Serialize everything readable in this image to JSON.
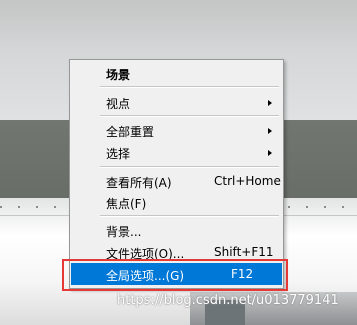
{
  "watermark": "https://blog.csdn.net/u013779141",
  "menu": {
    "header": {
      "label": "场景"
    },
    "items": [
      {
        "label": "视点",
        "shortcut": "",
        "submenu": true
      },
      {
        "label": "全部重置",
        "shortcut": "",
        "submenu": true
      },
      {
        "label": "选择",
        "shortcut": "",
        "submenu": true
      },
      {
        "label": "查看所有(A)",
        "shortcut": "Ctrl+Home",
        "submenu": false
      },
      {
        "label": "焦点(F)",
        "shortcut": "",
        "submenu": false
      },
      {
        "label": "背景...",
        "shortcut": "",
        "submenu": false
      },
      {
        "label": "文件选项(O)...",
        "shortcut": "Shift+F11",
        "submenu": false
      },
      {
        "label": "全局选项...(G)",
        "shortcut": "F12",
        "submenu": false,
        "selected": true
      }
    ]
  },
  "colors": {
    "selection": "#0078d7",
    "annotation_box": "#e53935",
    "menu_background": "#f0f0f0"
  }
}
